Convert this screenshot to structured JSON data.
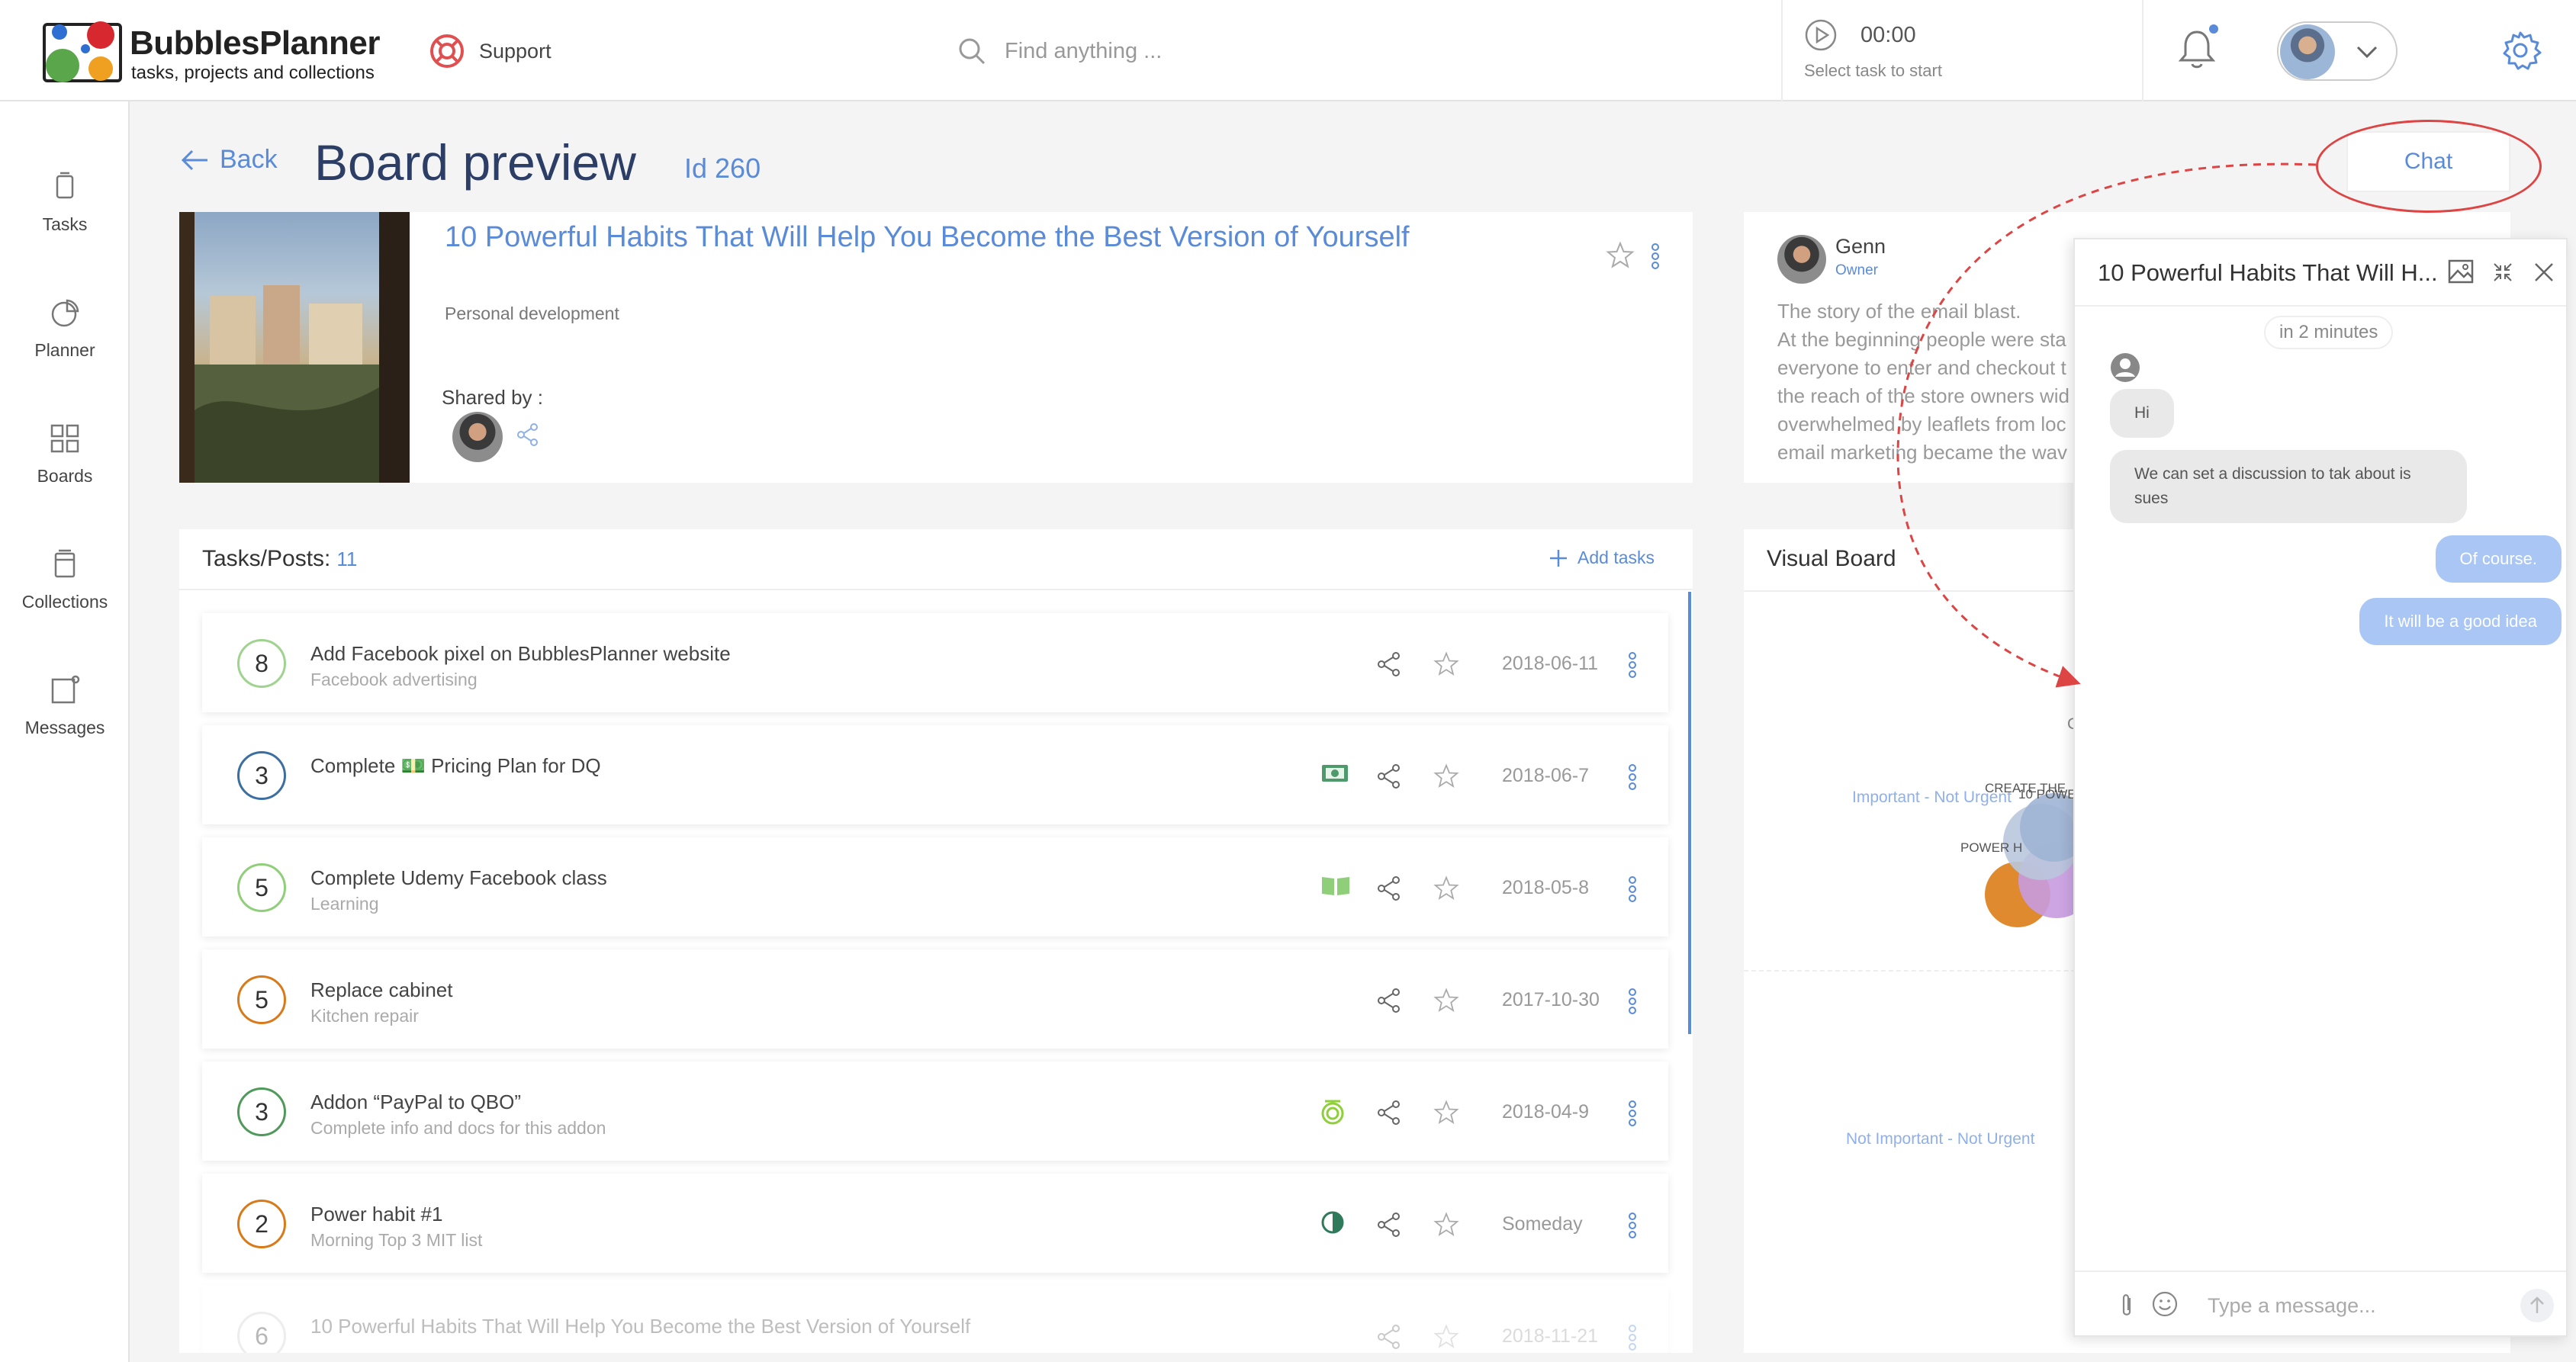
{
  "app": {
    "name": "BubblesPlanner",
    "tagline": "tasks, projects and collections",
    "colors": {
      "accent": "#5a8bd8",
      "title": "#2c3e66",
      "annotation": "#dd4444"
    }
  },
  "topbar": {
    "support_label": "Support",
    "search_placeholder": "Find anything ...",
    "timer_time": "00:00",
    "timer_hint": "Select task to start"
  },
  "sidebar": {
    "items": [
      {
        "label": "Tasks",
        "icon": "tasks-icon"
      },
      {
        "label": "Planner",
        "icon": "planner-icon"
      },
      {
        "label": "Boards",
        "icon": "boards-icon"
      },
      {
        "label": "Collections",
        "icon": "collections-icon"
      },
      {
        "label": "Messages",
        "icon": "messages-icon"
      }
    ]
  },
  "header": {
    "back_label": "Back",
    "title": "Board preview",
    "id_label": "Id 260",
    "chat_button": "Chat"
  },
  "board": {
    "title": "10 Powerful Habits That Will Help You Become the Best Version of Yourself",
    "category": "Personal development",
    "shared_by_label": "Shared by :"
  },
  "owner": {
    "name": "Genn",
    "role": "Owner",
    "story_lines": [
      "The story of the email blast.",
      "At the beginning people were sta",
      "everyone to enter and checkout t",
      "the reach of the store owners wid",
      "overwhelmed by leaflets from loc",
      "email marketing became the wav"
    ]
  },
  "tasks": {
    "label": "Tasks/Posts:",
    "count": "11",
    "add_label": "Add tasks",
    "rows": [
      {
        "priority": "8",
        "ring": "#9fd38f",
        "title": "Add Facebook pixel on BubblesPlanner website",
        "subtitle": "Facebook advertising",
        "tag_icon": "",
        "date": "2018-06-11"
      },
      {
        "priority": "3",
        "ring": "#3c6fa0",
        "title": "Complete 💵 Pricing Plan for DQ",
        "subtitle": "",
        "tag_icon": "money-icon",
        "date": "2018-06-7"
      },
      {
        "priority": "5",
        "ring": "#8fcf7a",
        "title": "Complete Udemy Facebook class",
        "subtitle": "Learning",
        "tag_icon": "book-icon",
        "date": "2018-05-8"
      },
      {
        "priority": "5",
        "ring": "#d97a1a",
        "title": "Replace cabinet",
        "subtitle": "Kitchen repair",
        "tag_icon": "",
        "date": "2017-10-30"
      },
      {
        "priority": "3",
        "ring": "#4f9a5a",
        "title": "Addon “PayPal to QBO”",
        "subtitle": "Complete info and docs for this addon",
        "tag_icon": "target-icon",
        "date": "2018-04-9"
      },
      {
        "priority": "2",
        "ring": "#d97a1a",
        "title": "Power habit #1",
        "subtitle": "Morning Top 3 MIT list",
        "tag_icon": "half-circle-icon",
        "date": "Someday"
      },
      {
        "priority": "6",
        "ring": "#cccccc",
        "title": "10 Powerful Habits That Will Help You Become the Best Version of Yourself",
        "subtitle": "",
        "tag_icon": "",
        "date": "2018-11-21"
      }
    ]
  },
  "visual_board": {
    "title": "Visual Board",
    "quadrants": {
      "top_right_partial": "C",
      "important_not_urgent": "Important - Not Urgent",
      "not_important_not_urgent": "Not Important - Not Urgent"
    },
    "bubble_labels": [
      "CREATE THE",
      "10 POWE",
      "POWER H"
    ]
  },
  "chat": {
    "title": "10 Powerful Habits That Will H...",
    "time_badge": "in 2 minutes",
    "messages": [
      {
        "from": "other",
        "text": "Hi"
      },
      {
        "from": "other",
        "text": "We can set a discussion to tak about is sues"
      },
      {
        "from": "me",
        "text": "Of course."
      },
      {
        "from": "me",
        "text": "It will be a good idea"
      }
    ],
    "input_placeholder": "Type a message..."
  }
}
